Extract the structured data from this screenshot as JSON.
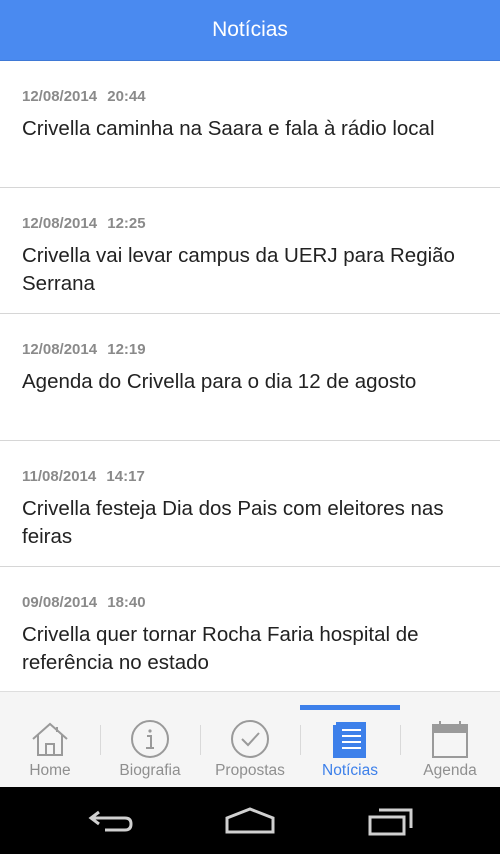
{
  "header": {
    "title": "Notícias"
  },
  "news": [
    {
      "date": "12/08/2014",
      "time": "20:44",
      "title": "Crivella caminha na Saara e fala à rádio local"
    },
    {
      "date": "12/08/2014",
      "time": "12:25",
      "title": "Crivella vai levar campus da UERJ para Região Serrana"
    },
    {
      "date": "12/08/2014",
      "time": "12:19",
      "title": "Agenda do Crivella para o dia 12 de agosto"
    },
    {
      "date": "11/08/2014",
      "time": "14:17",
      "title": "Crivella festeja Dia dos Pais com eleitores nas feiras"
    },
    {
      "date": "09/08/2014",
      "time": "18:40",
      "title": "Crivella quer tornar Rocha Faria hospital de referência no estado"
    }
  ],
  "tabs": [
    {
      "label": "Home",
      "icon": "home-icon",
      "active": false
    },
    {
      "label": "Biografia",
      "icon": "info-icon",
      "active": false
    },
    {
      "label": "Propostas",
      "icon": "check-circle-icon",
      "active": false
    },
    {
      "label": "Notícias",
      "icon": "news-list-icon",
      "active": true
    },
    {
      "label": "Agenda",
      "icon": "calendar-icon",
      "active": false
    }
  ],
  "colors": {
    "accent": "#4a8af0",
    "active_tab": "#3d80ea",
    "inactive_tab": "#8f8f8f"
  },
  "system_nav": [
    "back-icon",
    "home-icon",
    "recent-apps-icon"
  ]
}
